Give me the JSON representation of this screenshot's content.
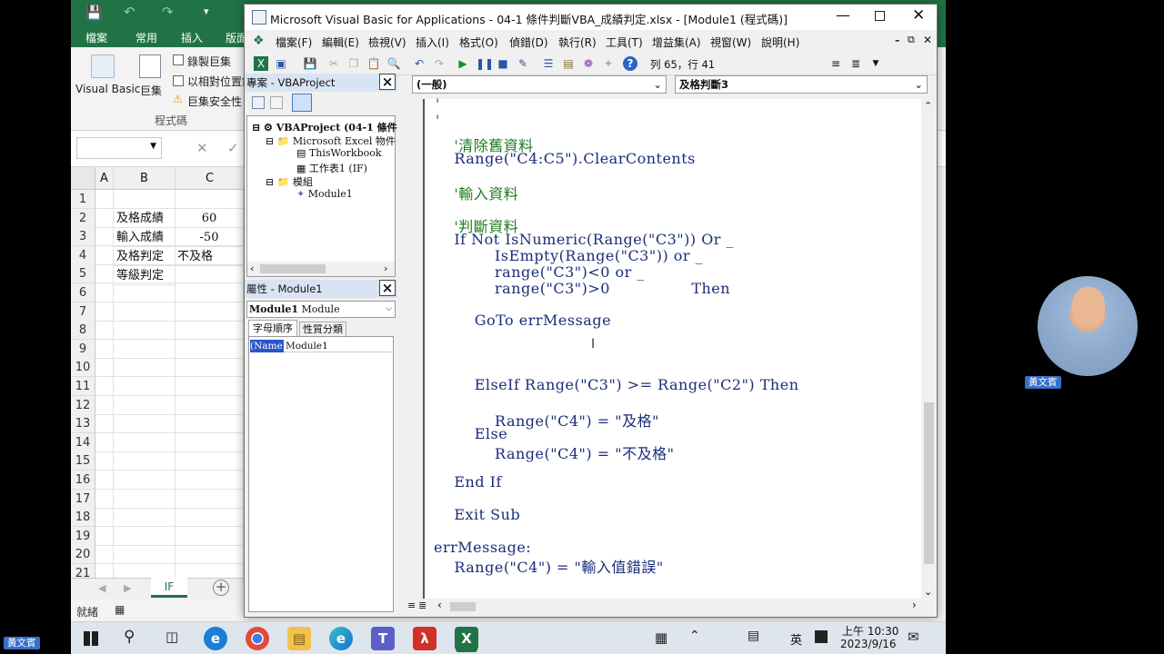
{
  "excel": {
    "tabs": [
      "檔案",
      "常用",
      "插入",
      "版面"
    ],
    "ribbon": {
      "visual_basic": "Visual Basic",
      "macros": "巨集",
      "record_macro": "錄製巨集",
      "relative_ref": "以相對位置錄",
      "macro_security": "巨集安全性",
      "group_label": "程式碼"
    },
    "columns": [
      "A",
      "B",
      "C"
    ],
    "rows": [
      "1",
      "2",
      "3",
      "4",
      "5",
      "6",
      "7",
      "8",
      "9",
      "10",
      "11",
      "12",
      "13",
      "14",
      "15",
      "16",
      "17",
      "18",
      "19",
      "20",
      "21"
    ],
    "cells": {
      "b2": "及格成績",
      "c2": "60",
      "b3": "輸入成績",
      "c3": "-50",
      "b4": "及格判定",
      "c4": "不及格",
      "b5": "等級判定"
    },
    "sheet_tab": "IF",
    "status": "就緒"
  },
  "vbe": {
    "title": "Microsoft Visual Basic for Applications - 04-1 條件判斷VBA_成績判定.xlsx - [Module1 (程式碼)]",
    "menu": [
      "檔案(F)",
      "編輯(E)",
      "檢視(V)",
      "插入(I)",
      "格式(O)",
      "偵錯(D)",
      "執行(R)",
      "工具(T)",
      "增益集(A)",
      "視窗(W)",
      "說明(H)"
    ],
    "cursor_pos": "列 65，行 41",
    "project_pane": {
      "title": "專案 - VBAProject",
      "root": "VBAProject (04-1 條件",
      "excel_objects": "Microsoft Excel 物件",
      "thisworkbook": "ThisWorkbook",
      "sheet1": "工作表1 (IF)",
      "modules": "模組",
      "module1": "Module1"
    },
    "props_pane": {
      "title": "屬性 - Module1",
      "object": "Module1",
      "object_type": "Module",
      "tab_alpha": "字母順序",
      "tab_category": "性質分類",
      "prop_name": "(Name)",
      "prop_value": "Module1"
    },
    "object_dropdown": "(一般)",
    "proc_dropdown": "及格判斷3",
    "code_lines": [
      {
        "text": "'",
        "indent": 0,
        "comment": true
      },
      {
        "text": "'",
        "indent": 0,
        "comment": true
      },
      {
        "text": "    '清除舊資料",
        "comment": true
      },
      {
        "text": "    Range(\"C4:C5\").ClearContents",
        "comment": false
      },
      {
        "text": "    '輸入資料",
        "comment": true
      },
      {
        "text": "    '判斷資料",
        "comment": true
      },
      {
        "text": "    If Not IsNumeric(Range(\"C3\")) Or _",
        "comment": false
      },
      {
        "text": "            IsEmpty(Range(\"C3\")) or _",
        "comment": false
      },
      {
        "text": "            range(\"C3\")<0 or _",
        "comment": false
      },
      {
        "text": "            range(\"C3\")>0                Then",
        "comment": false
      },
      {
        "text": "        GoTo errMessage",
        "comment": false
      },
      {
        "text": "        ElseIf Range(\"C3\") >= Range(\"C2\") Then",
        "comment": false
      },
      {
        "text": "            Range(\"C4\") = \"及格\"",
        "comment": false
      },
      {
        "text": "        Else",
        "comment": false
      },
      {
        "text": "            Range(\"C4\") = \"不及格\"",
        "comment": false
      },
      {
        "text": "    End If",
        "comment": false
      },
      {
        "text": "    Exit Sub",
        "comment": false
      },
      {
        "text": "errMessage:",
        "comment": false
      },
      {
        "text": "    Range(\"C4\") = \"輸入值錯誤\"",
        "comment": false
      }
    ]
  },
  "taskbar": {
    "ime": "英",
    "time": "上午 10:30",
    "date": "2023/9/16"
  },
  "presenter": {
    "name": "黃文賓",
    "name_corner": "黃文賓"
  },
  "colors": {
    "excel_green": "#217346",
    "code_keyword": "#1a2d7a",
    "code_comment": "#1e7b1e"
  }
}
